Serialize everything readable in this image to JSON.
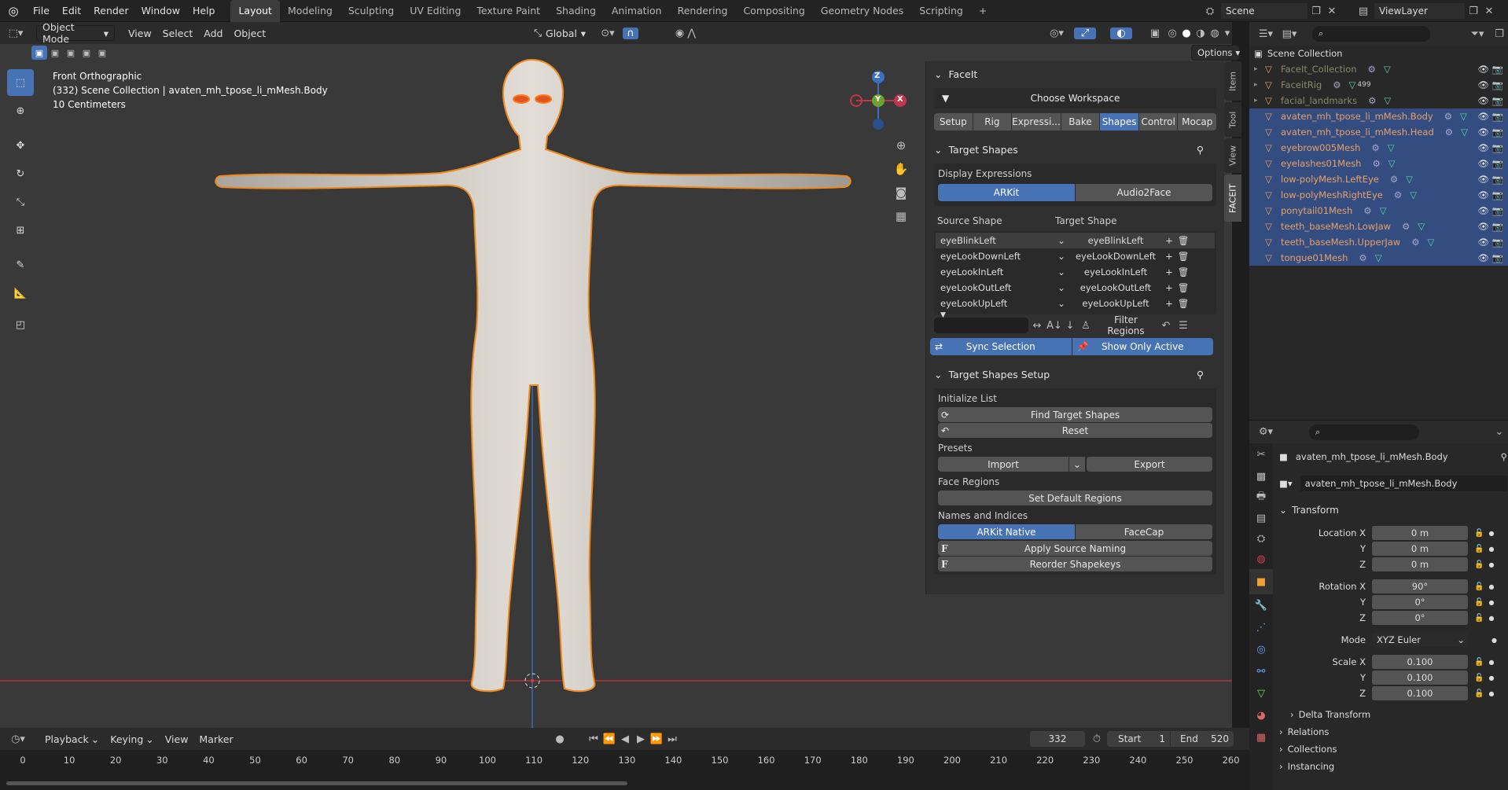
{
  "topbar": {
    "menus": [
      "File",
      "Edit",
      "Render",
      "Window",
      "Help"
    ],
    "workspaces": [
      "Layout",
      "Modeling",
      "Sculpting",
      "UV Editing",
      "Texture Paint",
      "Shading",
      "Animation",
      "Rendering",
      "Compositing",
      "Geometry Nodes",
      "Scripting"
    ],
    "active_workspace": "Layout",
    "plus": "+",
    "scene": "Scene",
    "view_layer": "ViewLayer"
  },
  "viewport": {
    "mode": "Object Mode",
    "menus": [
      "View",
      "Select",
      "Add",
      "Object"
    ],
    "orientation": "Global",
    "options": "Options",
    "info": [
      "Front Orthographic",
      "(332) Scene Collection | avaten_mh_tpose_li_mMesh.Body",
      "10 Centimeters"
    ],
    "gizmo": {
      "z": "Z",
      "y": "Y",
      "x": "X"
    }
  },
  "npanel": {
    "title": "FaceIt",
    "workspace_label": "Choose Workspace",
    "tabs": [
      "Setup",
      "Rig",
      "Expressi...",
      "Bake",
      "Shapes",
      "Control",
      "Mocap"
    ],
    "active_tab": "Shapes",
    "target_shapes": {
      "title": "Target Shapes",
      "display_expressions": "Display Expressions",
      "modes": [
        "ARKit",
        "Audio2Face"
      ],
      "col_source": "Source Shape",
      "col_target": "Target Shape",
      "rows": [
        {
          "source": "eyeBlinkLeft",
          "target": "eyeBlinkLeft"
        },
        {
          "source": "eyeLookDownLeft",
          "target": "eyeLookDownLeft"
        },
        {
          "source": "eyeLookInLeft",
          "target": "eyeLookInLeft"
        },
        {
          "source": "eyeLookOutLeft",
          "target": "eyeLookOutLeft"
        },
        {
          "source": "eyeLookUpLeft",
          "target": "eyeLookUpLeft"
        }
      ],
      "filter_regions": "Filter Regions",
      "sync_selection": "Sync Selection",
      "show_only_active": "Show Only Active"
    },
    "setup": {
      "title": "Target Shapes Setup",
      "initialize": "Initialize List",
      "find": "Find Target Shapes",
      "reset": "Reset",
      "presets": "Presets",
      "import": "Import",
      "export": "Export",
      "face_regions": "Face Regions",
      "set_default": "Set Default Regions",
      "names_indices": "Names and Indices",
      "naming": [
        "ARKit Native",
        "FaceCap"
      ],
      "apply_source": "Apply Source Naming",
      "reorder": "Reorder Shapekeys"
    },
    "side_tabs": [
      "Item",
      "Tool",
      "View",
      "FACEIT"
    ]
  },
  "outliner": {
    "header": "Scene Collection",
    "items": [
      {
        "name": "FaceIt_Collection",
        "sel": false,
        "dim": true
      },
      {
        "name": "FaceitRig",
        "sel": false,
        "dim": true,
        "badge": "499"
      },
      {
        "name": "facial_landmarks",
        "sel": false,
        "dim": true
      },
      {
        "name": "avaten_mh_tpose_li_mMesh.Body",
        "sel": true
      },
      {
        "name": "avaten_mh_tpose_li_mMesh.Head",
        "sel": true
      },
      {
        "name": "eyebrow005Mesh",
        "sel": true
      },
      {
        "name": "eyelashes01Mesh",
        "sel": true
      },
      {
        "name": "low-polyMesh.LeftEye",
        "sel": true
      },
      {
        "name": "low-polyMeshRightEye",
        "sel": true
      },
      {
        "name": "ponytail01Mesh",
        "sel": true
      },
      {
        "name": "teeth_baseMesh.LowJaw",
        "sel": true
      },
      {
        "name": "teeth_baseMesh.UpperJaw",
        "sel": true
      },
      {
        "name": "tongue01Mesh",
        "sel": true
      }
    ]
  },
  "properties": {
    "object": "avaten_mh_tpose_li_mMesh.Body",
    "object_field": "avaten_mh_tpose_li_mMesh.Body",
    "transform": "Transform",
    "location": {
      "label": "Location X",
      "x": "0 m",
      "y": "0 m",
      "z": "0 m"
    },
    "rotation": {
      "label": "Rotation X",
      "x": "90°",
      "y": "0°",
      "z": "0°"
    },
    "mode_label": "Mode",
    "mode": "XYZ Euler",
    "scale": {
      "label": "Scale X",
      "x": "0.100",
      "y": "0.100",
      "z": "0.100"
    },
    "axis_y": "Y",
    "axis_z": "Z",
    "sections": [
      "Delta Transform",
      "Relations",
      "Collections",
      "Instancing"
    ]
  },
  "timeline": {
    "menus": [
      "Playback",
      "Keying",
      "View",
      "Marker"
    ],
    "frame": "332",
    "start_label": "Start",
    "start": "1",
    "end_label": "End",
    "end": "520",
    "ticks": [
      "0",
      "10",
      "20",
      "30",
      "40",
      "50",
      "60",
      "70",
      "80",
      "90",
      "100",
      "110",
      "120",
      "130",
      "140",
      "150",
      "160",
      "170",
      "180",
      "190",
      "200",
      "210",
      "220",
      "230",
      "240",
      "250",
      "260"
    ]
  }
}
